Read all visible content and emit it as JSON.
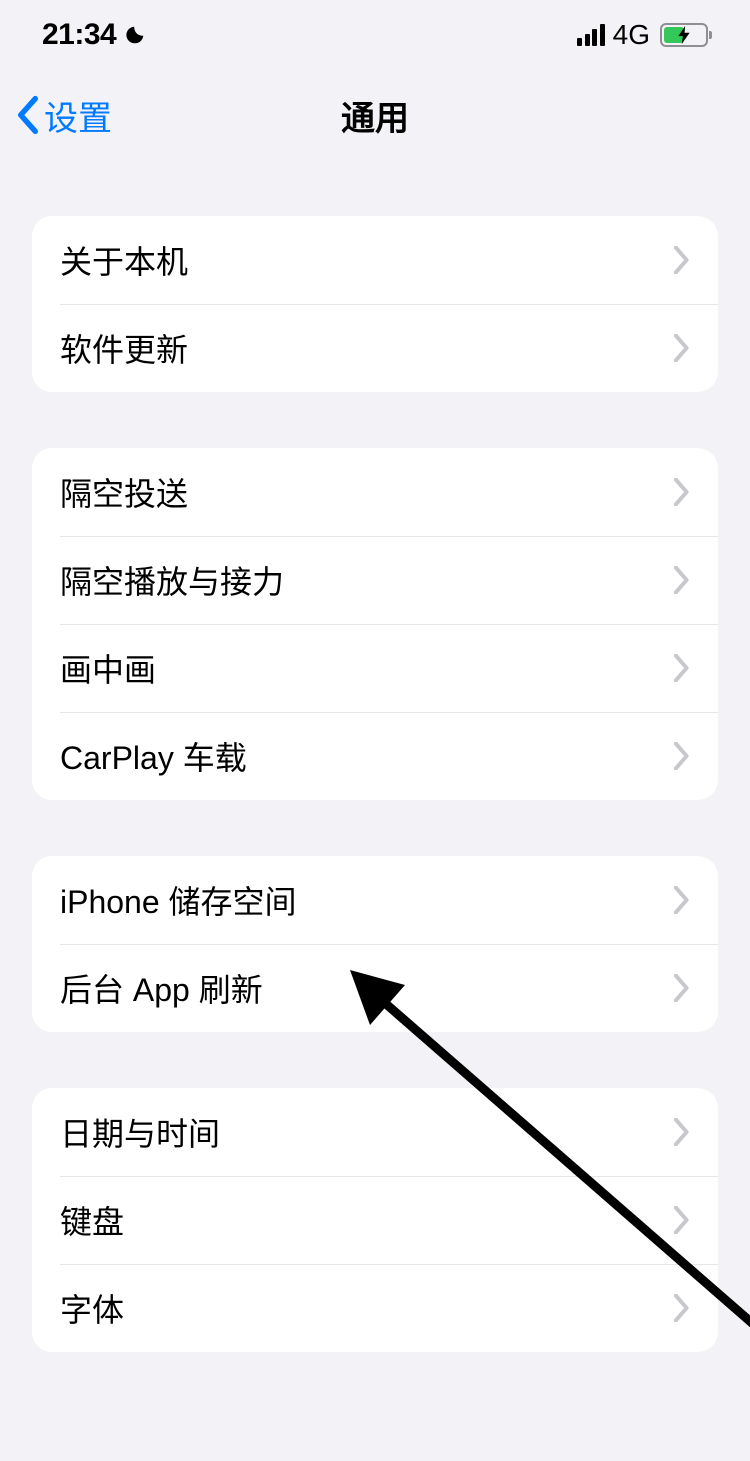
{
  "status": {
    "time": "21:34",
    "network": "4G"
  },
  "nav": {
    "back": "设置",
    "title": "通用"
  },
  "groups": [
    {
      "items": [
        "关于本机",
        "软件更新"
      ]
    },
    {
      "items": [
        "隔空投送",
        "隔空播放与接力",
        "画中画",
        "CarPlay 车载"
      ]
    },
    {
      "items": [
        "iPhone 储存空间",
        "后台 App 刷新"
      ]
    },
    {
      "items": [
        "日期与时间",
        "键盘",
        "字体"
      ]
    }
  ]
}
